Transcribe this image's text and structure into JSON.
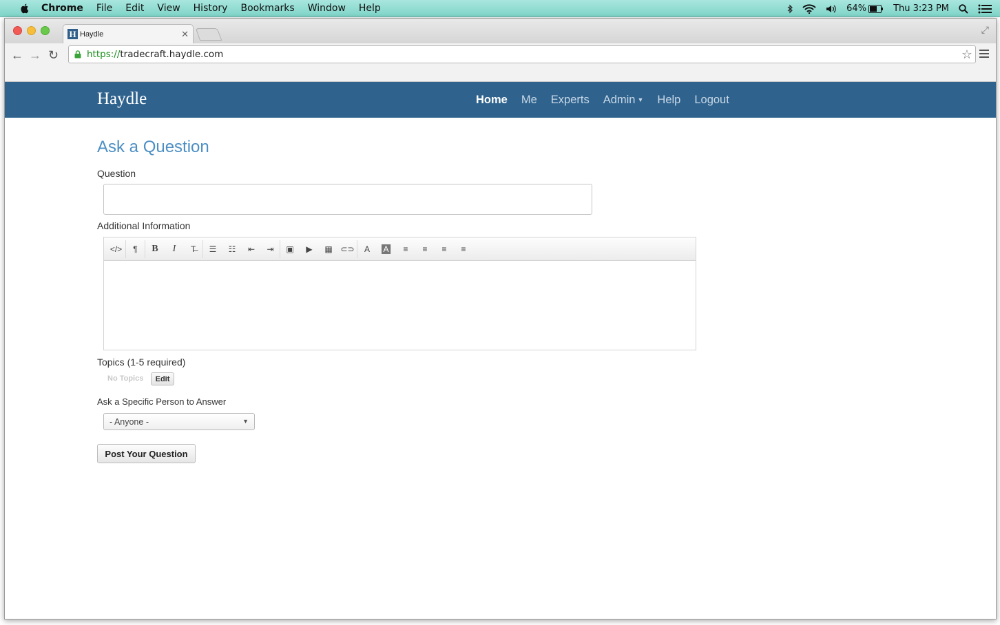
{
  "menubar": {
    "app": "Chrome",
    "items": [
      "File",
      "Edit",
      "View",
      "History",
      "Bookmarks",
      "Window",
      "Help"
    ],
    "battery": "64%",
    "clock": "Thu 3:23 PM"
  },
  "browser": {
    "tab_title": "Haydle",
    "favicon_letter": "H",
    "url_scheme": "https://",
    "url_host": "tradecraft.haydle.com"
  },
  "site": {
    "brand": "Haydle",
    "nav": [
      "Home",
      "Me",
      "Experts",
      "Admin",
      "Help",
      "Logout"
    ]
  },
  "form": {
    "page_title": "Ask a Question",
    "question_label": "Question",
    "question_value": "",
    "additional_label": "Additional Information",
    "topics_label": "Topics (1-5 required)",
    "no_topics": "No Topics",
    "edit_label": "Edit",
    "ask_person_label": "Ask a Specific Person to Answer",
    "ask_person_value": "- Anyone -",
    "post_label": "Post Your Question"
  },
  "editor_toolbar": [
    {
      "icon": "html-code-icon",
      "glyph": "</>"
    },
    {
      "icon": "paragraph-icon",
      "glyph": "¶"
    },
    {
      "icon": "bold-icon",
      "glyph": "B"
    },
    {
      "icon": "italic-icon",
      "glyph": "I"
    },
    {
      "icon": "strikethrough-icon",
      "glyph": "T̶"
    },
    {
      "icon": "bullet-list-icon",
      "glyph": "☰"
    },
    {
      "icon": "numbered-list-icon",
      "glyph": "☷"
    },
    {
      "icon": "outdent-icon",
      "glyph": "⇤"
    },
    {
      "icon": "indent-icon",
      "glyph": "⇥"
    },
    {
      "icon": "image-icon",
      "glyph": "▣"
    },
    {
      "icon": "video-icon",
      "glyph": "▶"
    },
    {
      "icon": "table-icon",
      "glyph": "▦"
    },
    {
      "icon": "link-icon",
      "glyph": "⊂⊃"
    },
    {
      "icon": "font-color-icon",
      "glyph": "A"
    },
    {
      "icon": "background-color-icon",
      "glyph": "A"
    },
    {
      "icon": "align-left-icon",
      "glyph": "≡"
    },
    {
      "icon": "align-center-icon",
      "glyph": "≡"
    },
    {
      "icon": "align-right-icon",
      "glyph": "≡"
    },
    {
      "icon": "justify-icon",
      "glyph": "≡"
    }
  ],
  "colors": {
    "navbar": "#2f638e",
    "title": "#4c8fc4",
    "menubar": "#8fdcd2"
  }
}
